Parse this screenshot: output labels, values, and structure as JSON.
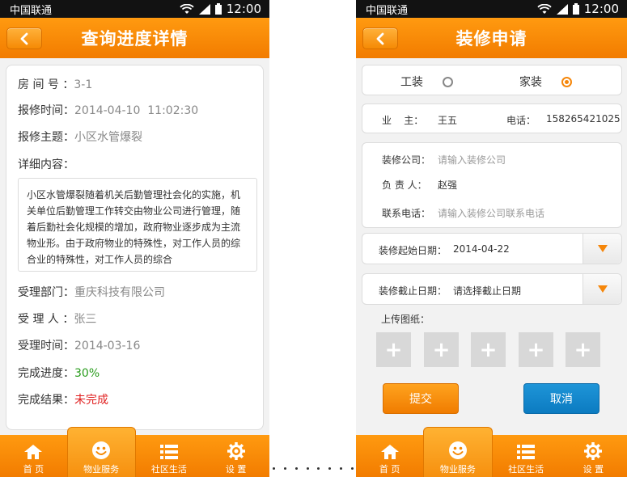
{
  "colors": {
    "accent": "#f5860a",
    "progress": "#2a9d1e",
    "result": "#e02020",
    "cancel": "#117fc6"
  },
  "status_bar": {
    "carrier": "中国联通",
    "time": "12:00"
  },
  "tabs": [
    {
      "label": "首 页",
      "icon": "home-icon"
    },
    {
      "label": "物业服务",
      "icon": "smiley-icon"
    },
    {
      "label": "社区生活",
      "icon": "list-icon"
    },
    {
      "label": "设 置",
      "icon": "gear-icon"
    }
  ],
  "left": {
    "title": "查询进度详情",
    "room": {
      "label": "房 间 号 ：",
      "value": "3-1"
    },
    "report_time": {
      "label": "报修时间：",
      "value": "2014-04-10  11:02:30"
    },
    "report_subject": {
      "label": "报修主题：",
      "value": "小区水管爆裂"
    },
    "detail_label": "详细内容：",
    "detail_text": "小区水管爆裂随着机关后勤管理社会化的实施，机关单位后勤管理工作转交由物业公司进行管理，随着后勤社会化规模的增加，政府物业逐步成为主流物业形。由于政府物业的特殊性，对工作人员的综合业的特殊性，对工作人员的综合",
    "dept": {
      "label": "受理部门：",
      "value": "重庆科技有限公司"
    },
    "handler": {
      "label": "受 理 人 ：",
      "value": "张三"
    },
    "accept_time": {
      "label": "受理时间：",
      "value": "2014-03-16"
    },
    "progress": {
      "label": "完成进度：",
      "value": "30%"
    },
    "result": {
      "label": "完成结果：",
      "value": "未完成"
    }
  },
  "right": {
    "title": "装修申请",
    "type_options": [
      {
        "label": "工装",
        "selected": false
      },
      {
        "label": "家装",
        "selected": true
      }
    ],
    "owner": {
      "label": "业    主：",
      "value": "王五"
    },
    "phone": {
      "label": "电话：",
      "value": "158265421025"
    },
    "company": {
      "label": "装修公司：",
      "placeholder": "请输入装修公司"
    },
    "manager": {
      "label": "负 责 人：",
      "value": "赵强"
    },
    "contact": {
      "label": "联系电话：",
      "placeholder": "请输入装修公司联系电话"
    },
    "start_date": {
      "label": "装修起始日期：",
      "value": "2014-04-22"
    },
    "end_date": {
      "label": "装修截止日期：",
      "value": "请选择截止日期"
    },
    "upload_label": "上传图纸：",
    "upload_slots": [
      "+",
      "+",
      "+",
      "+",
      "+"
    ],
    "submit_label": "提交",
    "cancel_label": "取消"
  }
}
